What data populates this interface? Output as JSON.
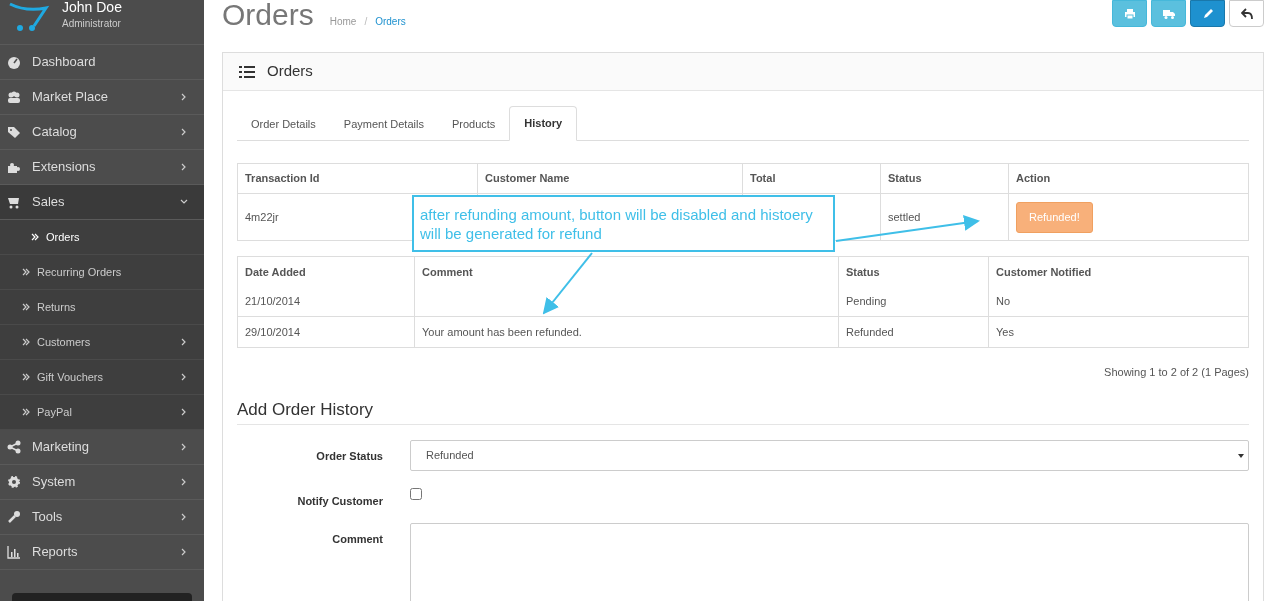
{
  "user": {
    "name": "John Doe",
    "role": "Administrator"
  },
  "sidebar": {
    "items": [
      {
        "label": "Dashboard",
        "has_submenu": false,
        "expanded": false
      },
      {
        "label": "Market Place",
        "has_submenu": true,
        "expanded": false
      },
      {
        "label": "Catalog",
        "has_submenu": true,
        "expanded": false
      },
      {
        "label": "Extensions",
        "has_submenu": true,
        "expanded": false
      },
      {
        "label": "Sales",
        "has_submenu": true,
        "expanded": true,
        "children": [
          {
            "label": "Orders",
            "selected": true,
            "has_submenu": false
          },
          {
            "label": "Recurring Orders",
            "selected": false,
            "has_submenu": false
          },
          {
            "label": "Returns",
            "selected": false,
            "has_submenu": false
          },
          {
            "label": "Customers",
            "selected": false,
            "has_submenu": true
          },
          {
            "label": "Gift Vouchers",
            "selected": false,
            "has_submenu": true
          },
          {
            "label": "PayPal",
            "selected": false,
            "has_submenu": true
          }
        ]
      },
      {
        "label": "Marketing",
        "has_submenu": true,
        "expanded": false
      },
      {
        "label": "System",
        "has_submenu": true,
        "expanded": false
      },
      {
        "label": "Tools",
        "has_submenu": true,
        "expanded": false
      },
      {
        "label": "Reports",
        "has_submenu": true,
        "expanded": false
      }
    ]
  },
  "page": {
    "title": "Orders",
    "breadcrumb_separator": "/",
    "breadcrumb": [
      {
        "label": "Home",
        "current": false
      },
      {
        "label": "Orders",
        "current": true
      }
    ]
  },
  "header_buttons": [
    {
      "kind": "print"
    },
    {
      "kind": "truck"
    },
    {
      "kind": "edit"
    },
    {
      "kind": "back"
    }
  ],
  "panel": {
    "title": "Orders"
  },
  "tabs": [
    {
      "label": "Order Details",
      "selected": false
    },
    {
      "label": "Payment Details",
      "selected": false
    },
    {
      "label": "Products",
      "selected": false
    },
    {
      "label": "History",
      "selected": true
    }
  ],
  "transactions": {
    "columns": [
      "Transaction Id",
      "Customer Name",
      "Total",
      "Status",
      "Action"
    ],
    "rows": [
      {
        "transaction_id": "4m22jr",
        "status": "settled",
        "action": {
          "label": "Refunded!",
          "disabled": true
        }
      }
    ]
  },
  "history": {
    "columns": [
      "Date Added",
      "Comment",
      "Status",
      "Customer Notified"
    ],
    "rows": [
      {
        "date": "21/10/2014",
        "status": "Pending",
        "notified": "No"
      },
      {
        "date": "29/10/2014",
        "comment": "Your amount has been refunded.",
        "status": "Refunded",
        "notified": "Yes"
      }
    ]
  },
  "pagination": "Showing 1 to 2 of 2 (1 Pages)",
  "add_history": {
    "title": "Add Order History",
    "order_status": {
      "label": "Order Status",
      "value": "Refunded"
    },
    "notify": {
      "label": "Notify Customer",
      "checked": false
    },
    "comment": {
      "label": "Comment"
    }
  },
  "annotation": "after refunding amount, button will be disabled and histoery will be generated for refund"
}
